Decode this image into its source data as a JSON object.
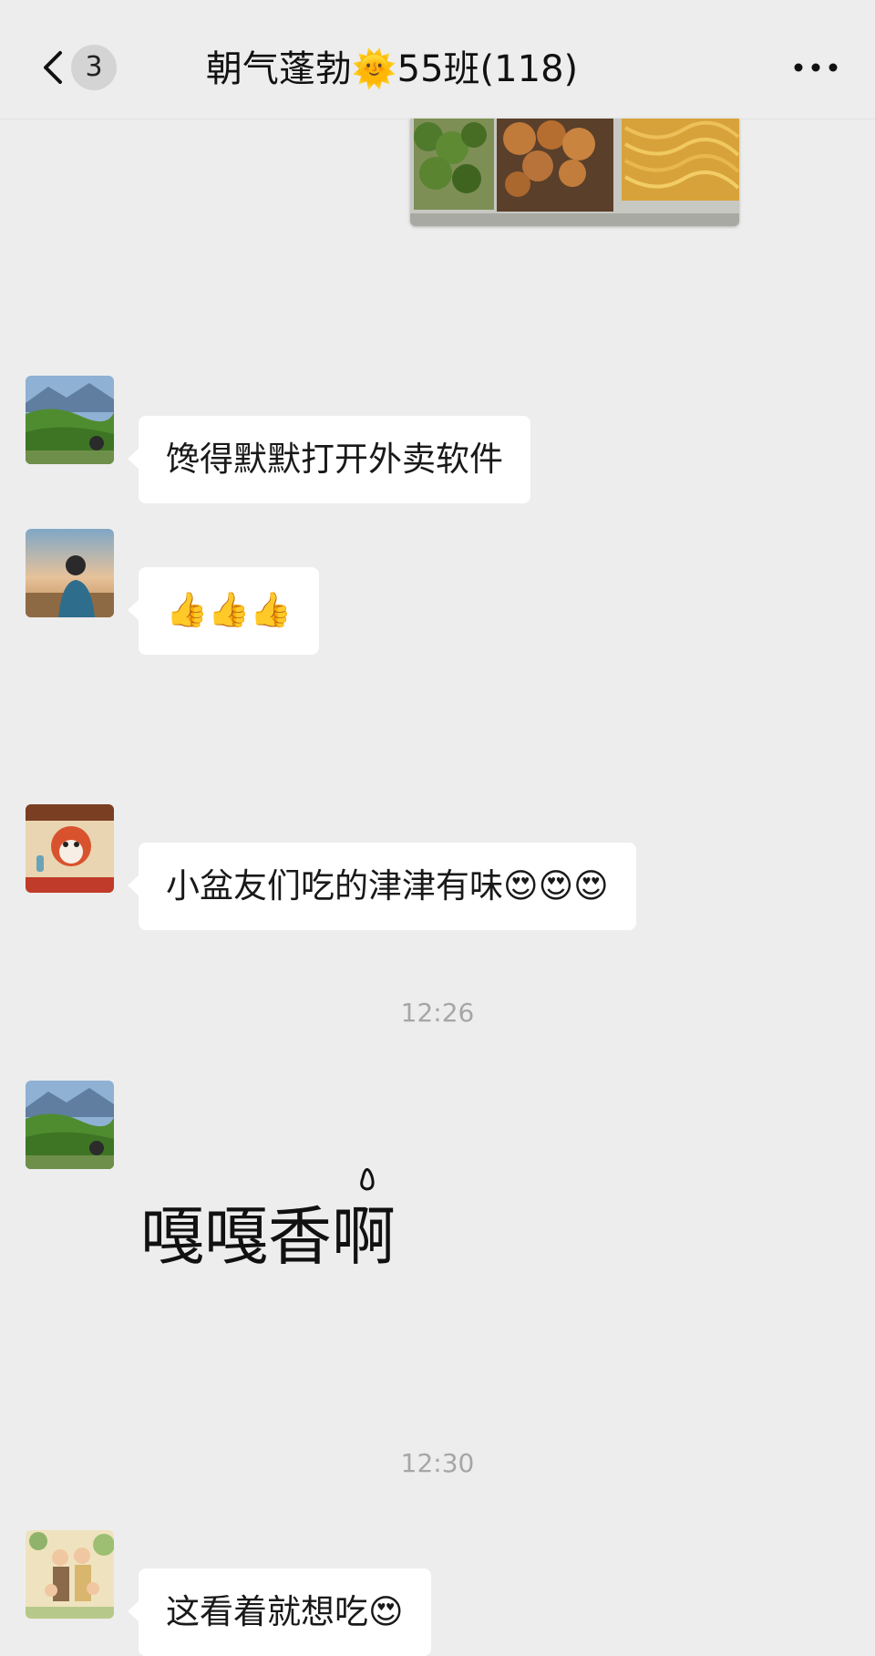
{
  "header": {
    "unread_count": "3",
    "title": "朝气蓬勃🌞55班(118)"
  },
  "messages": [
    {
      "text": "馋得默默打开外卖软件"
    },
    {
      "text": "👍👍👍"
    },
    {
      "text": "小盆友们吃的津津有味😍😍😍"
    },
    {
      "sticker_text": "嘎嘎香啊"
    },
    {
      "text": "这看着就想吃😍"
    }
  ],
  "timestamps": [
    "12:26",
    "12:30"
  ],
  "colors": {
    "background": "#ededed",
    "bubble": "#ffffff",
    "timestamp": "#a6a6a6"
  },
  "icons": [
    "back-chevron-icon",
    "more-icon",
    "thumbs-up-icon",
    "heart-eyes-icon"
  ]
}
